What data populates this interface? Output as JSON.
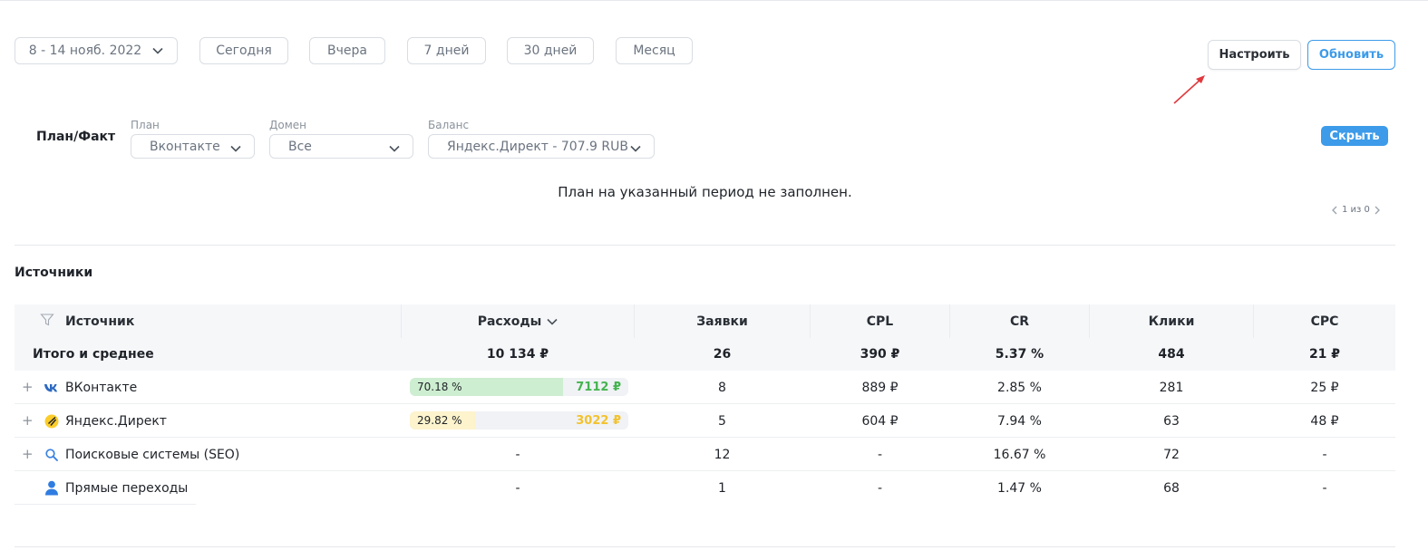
{
  "date_range": {
    "selected": "8 - 14 нояб. 2022",
    "presets": [
      "Сегодня",
      "Вчера",
      "7 дней",
      "30 дней",
      "Месяц"
    ]
  },
  "actions": {
    "settings_label": "Настроить",
    "refresh_label": "Обновить"
  },
  "plan_fact": {
    "title": "План/Факт",
    "filters": [
      {
        "label": "План",
        "value": "Вконтакте"
      },
      {
        "label": "Домен",
        "value": "Все"
      },
      {
        "label": "Баланс",
        "value": "Яндекс.Директ - 707.9 RUB"
      }
    ],
    "hide_label": "Скрыть",
    "empty_message": "План на указанный период не заполнен.",
    "pager": "1 из 0"
  },
  "sources": {
    "title": "Источники",
    "columns": [
      "Источник",
      "Расходы",
      "Заявки",
      "CPL",
      "CR",
      "Клики",
      "CPC"
    ],
    "total": {
      "label": "Итого и среднее",
      "expenses": "10 134 ₽",
      "leads": "26",
      "cpl": "390 ₽",
      "cr": "5.37 %",
      "clicks": "484",
      "cpc": "21 ₽"
    },
    "rows": [
      {
        "name": "ВКонтакте",
        "icon": "vk-icon",
        "expandable": true,
        "share_label": "70.18 %",
        "share": 70.18,
        "amount": "7112 ₽",
        "bar_color": "#cdeed0",
        "amount_color": "#45b34f",
        "leads": "8",
        "cpl": "889 ₽",
        "cr": "2.85 %",
        "clicks": "281",
        "cpc": "25 ₽"
      },
      {
        "name": "Яндекс.Директ",
        "icon": "yandex-direct-icon",
        "expandable": true,
        "share_label": "29.82 %",
        "share": 29.82,
        "amount": "3022 ₽",
        "bar_color": "#fdf3cc",
        "amount_color": "#f2c230",
        "leads": "5",
        "cpl": "604 ₽",
        "cr": "7.94 %",
        "clicks": "63",
        "cpc": "48 ₽"
      },
      {
        "name": "Поисковые системы (SEO)",
        "icon": "search-icon",
        "expandable": true,
        "expenses": "-",
        "leads": "12",
        "cpl": "-",
        "cr": "16.67 %",
        "clicks": "72",
        "cpc": "-"
      },
      {
        "name": "Прямые переходы",
        "icon": "user-icon",
        "expandable": false,
        "expenses": "-",
        "leads": "1",
        "cpl": "-",
        "cr": "1.47 %",
        "clicks": "68",
        "cpc": "-"
      }
    ]
  },
  "colors": {
    "accent": "#3d9be9",
    "annotation_arrow": "#e0393e"
  }
}
